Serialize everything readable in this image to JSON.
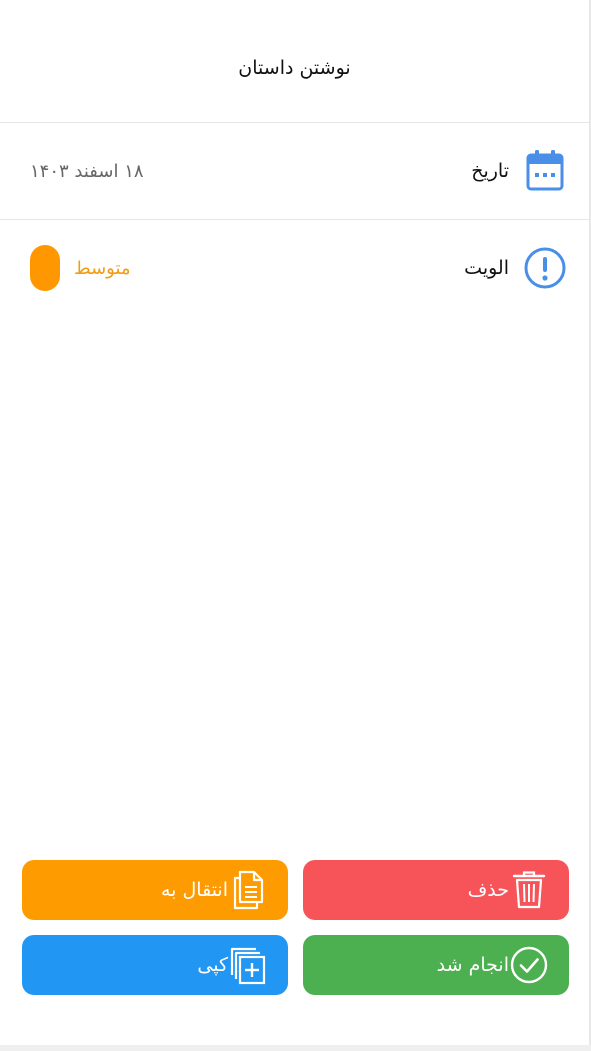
{
  "header": {
    "title": "نوشتن داستان"
  },
  "details": {
    "date": {
      "label": "تاریخ",
      "value": "۱۸ اسفند ۱۴۰۳",
      "icon": "calendar-icon"
    },
    "priority": {
      "label": "الویت",
      "value": "متوسط",
      "icon": "alert-circle-icon",
      "color": "#ff9800"
    }
  },
  "actions": {
    "delete": {
      "label": "حذف",
      "icon": "trash-icon",
      "color": "#f7545a"
    },
    "move": {
      "label": "انتقال به",
      "icon": "document-icon",
      "color": "#fd9b01"
    },
    "done": {
      "label": "انجام شد",
      "icon": "check-circle-icon",
      "color": "#4caf50"
    },
    "copy": {
      "label": "کپی",
      "icon": "copy-add-icon",
      "color": "#2196f3"
    }
  },
  "colors": {
    "accent_blue": "#4a8fe7"
  }
}
